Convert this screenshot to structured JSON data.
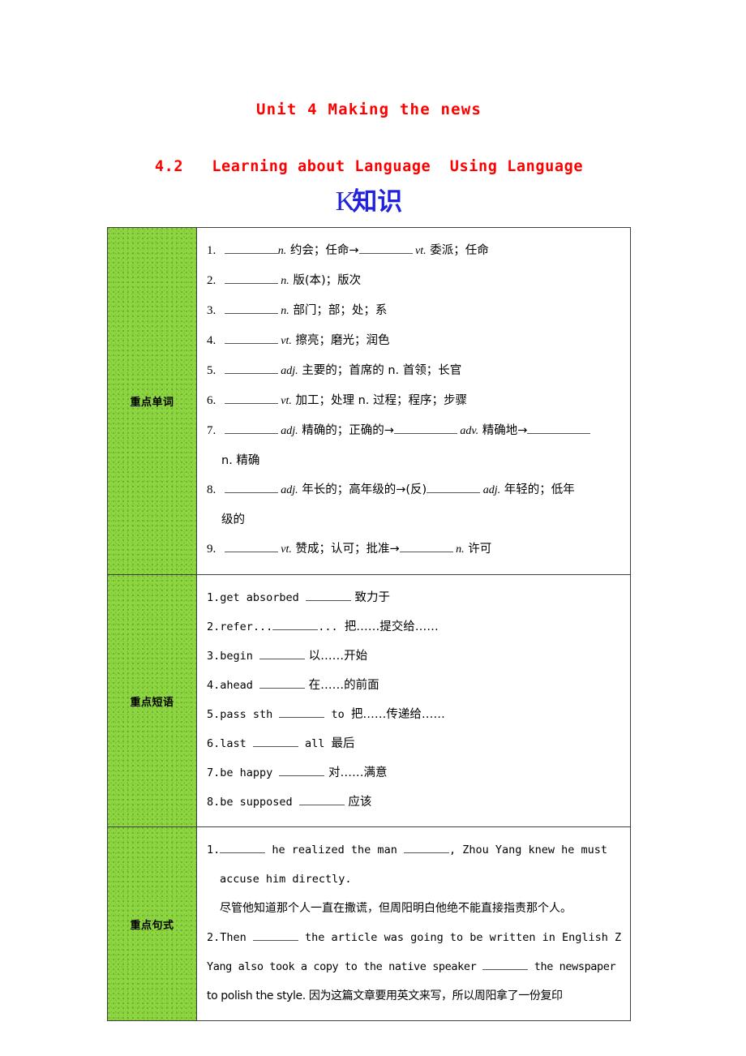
{
  "headings": {
    "unit": "Unit 4  Making the news",
    "section": "4.2   Learning about Language  Using Language",
    "k_letter": "K",
    "k_hanzi": "知识"
  },
  "table": {
    "rows": [
      {
        "label": "重点单词",
        "items": [
          {
            "num": "1.",
            "parts": [
              "__blank_md__",
              "n.",
              " 约会；任命→",
              "__blank_md__",
              " vt.",
              " 委派；任命"
            ]
          },
          {
            "num": "2.",
            "parts": [
              "__blank_md__",
              " n.",
              " 版(本)；版次"
            ]
          },
          {
            "num": "3.",
            "parts": [
              "__blank_md__",
              " n.",
              " 部门；部；处；系"
            ]
          },
          {
            "num": "4.",
            "parts": [
              "__blank_md__",
              " vt.",
              " 擦亮；磨光；润色"
            ]
          },
          {
            "num": "5.",
            "parts": [
              "__blank_md__",
              " adj.",
              " 主要的；首席的 n.",
              " 首领；长官"
            ]
          },
          {
            "num": "6.",
            "parts": [
              "__blank_md__",
              " vt.",
              " 加工；处理 n.",
              " 过程；程序；步骤"
            ]
          },
          {
            "num": "7.",
            "parts": [
              "__blank_md__",
              " adj.",
              " 精确的；正确的→",
              "__blank_lg__",
              " adv.",
              " 精确地→",
              "__blank_lg__"
            ],
            "cont": "n. 精确"
          },
          {
            "num": "8.",
            "parts": [
              "__blank_md__",
              " adj.",
              " 年长的；高年级的→(反)",
              "__blank_md__",
              " adj.",
              " 年轻的；低年"
            ],
            "cont": "级的"
          },
          {
            "num": "9.",
            "parts": [
              "__blank_md__",
              " vt.",
              " 赞成；认可；批准→",
              "__blank_md__",
              " n.",
              " 许可"
            ]
          }
        ]
      },
      {
        "label": "重点短语",
        "phrases": [
          {
            "num": "1.",
            "en": "get absorbed ",
            "blank": true,
            "cn": " 致力于"
          },
          {
            "num": "2.",
            "en": "refer...",
            "blank": true,
            "mid": "... ",
            "cn": "把……提交给……"
          },
          {
            "num": "3.",
            "en": "begin ",
            "blank": true,
            "cn": " 以……开始"
          },
          {
            "num": "4.",
            "en": "ahead ",
            "blank": true,
            "cn": " 在……的前面"
          },
          {
            "num": "5.",
            "en": "pass sth ",
            "blank": true,
            "mid": " to ",
            "cn": "把……传递给……"
          },
          {
            "num": "6.",
            "en": "last ",
            "blank": true,
            "mid": " all ",
            "cn": "最后"
          },
          {
            "num": "7.",
            "en": "be happy ",
            "blank": true,
            "cn": " 对……满意"
          },
          {
            "num": "8.",
            "en": "be supposed ",
            "blank": true,
            "cn": " 应该"
          }
        ]
      },
      {
        "label": "重点句式",
        "sentences": [
          {
            "num": "1.",
            "line1_a": "",
            "line1_b": " he realized the man ",
            "line1_c": ", Zhou Yang knew he must",
            "line2": "accuse him directly.",
            "cn": "尽管他知道那个人一直在撒谎，但周阳明白他绝不能直接指责那个人。"
          },
          {
            "num": "2.",
            "line1_a": "Then ",
            "line1_c": " the article was going to be written in English Z",
            "line2_a": "Yang   also took a copy to the native speaker ",
            "line2_c": " the newspaper",
            "line3": "to polish the style. 因为这篇文章要用英文来写，所以周阳拿了一份复印"
          }
        ]
      }
    ]
  }
}
